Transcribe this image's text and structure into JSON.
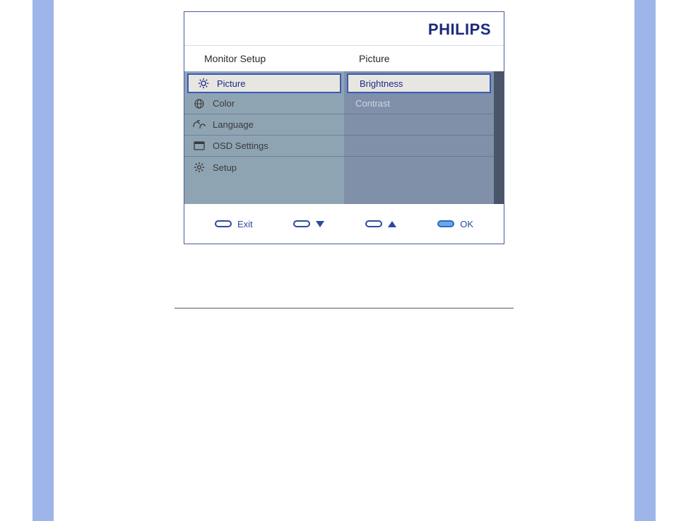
{
  "brand": "PHILIPS",
  "headers": {
    "left": "Monitor Setup",
    "right": "Picture"
  },
  "main_menu": [
    {
      "label": "Picture",
      "icon": "brightness-icon",
      "selected": true
    },
    {
      "label": "Color",
      "icon": "globe-icon",
      "selected": false
    },
    {
      "label": "Language",
      "icon": "language-icon",
      "selected": false
    },
    {
      "label": "OSD Settings",
      "icon": "window-icon",
      "selected": false
    },
    {
      "label": "Setup",
      "icon": "gear-icon",
      "selected": false
    }
  ],
  "sub_menu": [
    {
      "label": "Brightness",
      "selected": true
    },
    {
      "label": "Contrast",
      "selected": false
    }
  ],
  "nav": {
    "exit": "Exit",
    "ok": "OK"
  },
  "colors": {
    "brand_blue": "#1a2a7a",
    "panel_bg_left": "#8fa4b3",
    "panel_bg_right": "#8090a9",
    "highlight_border": "#3a5ab8",
    "highlight_bg": "#e8e6e0",
    "side_bars": "#9db5e8"
  }
}
